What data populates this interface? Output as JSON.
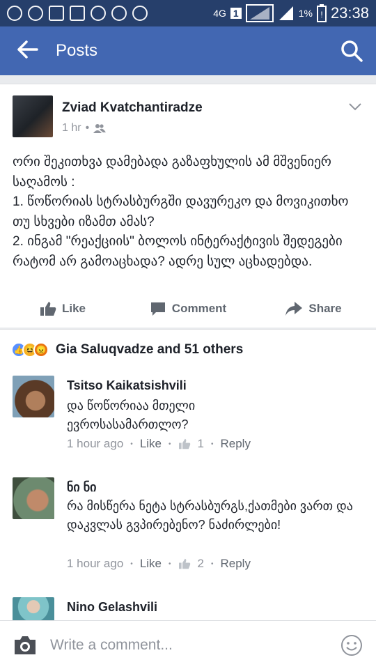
{
  "status_bar": {
    "network": "4G",
    "sim": "1",
    "battery": "1%",
    "time": "23:38"
  },
  "app_bar": {
    "title": "Posts"
  },
  "post": {
    "author": "Zviad Kvatchantiradze",
    "time": "1 hr",
    "text": "ორი შეკითხვა დამებადა გაზაფხულის ამ მშვენიერ საღამოს :\n1. წოწორიას სტრასბურგში დავურეკო და მოვიკითხო თუ სხვები იზამთ ამას?\n2. ინგამ \"რეაქციის\" ბოლოს ინტერაქტივის შედეგები რატომ არ გამოაცხადა?  ადრე სულ აცხადებდა.",
    "actions": {
      "like": "Like",
      "comment": "Comment",
      "share": "Share"
    }
  },
  "reactions": {
    "label": "Gia Saluqvadze and 51 others"
  },
  "comments": [
    {
      "name": "Tsitso Kaikatsishvili",
      "text": "და წოწორიაა მთელი ევროსასამართლო?",
      "time": "1 hour ago",
      "like": "Like",
      "likes": "1",
      "reply": "Reply"
    },
    {
      "name": "ნი ნი",
      "text": "რა მისწერა ნეტა სტრასბურგს,ქათმები ვართ და დაკვლას გვპირებენო? ნაძირლები!",
      "time": "1 hour ago",
      "like": "Like",
      "likes": "2",
      "reply": "Reply"
    },
    {
      "name": "Nino Gelashvili"
    }
  ],
  "composer": {
    "placeholder": "Write a comment..."
  },
  "colors": {
    "header": "#4267b2",
    "statusbar": "#263f6b",
    "text": "#1d2129",
    "muted": "#90949c"
  }
}
